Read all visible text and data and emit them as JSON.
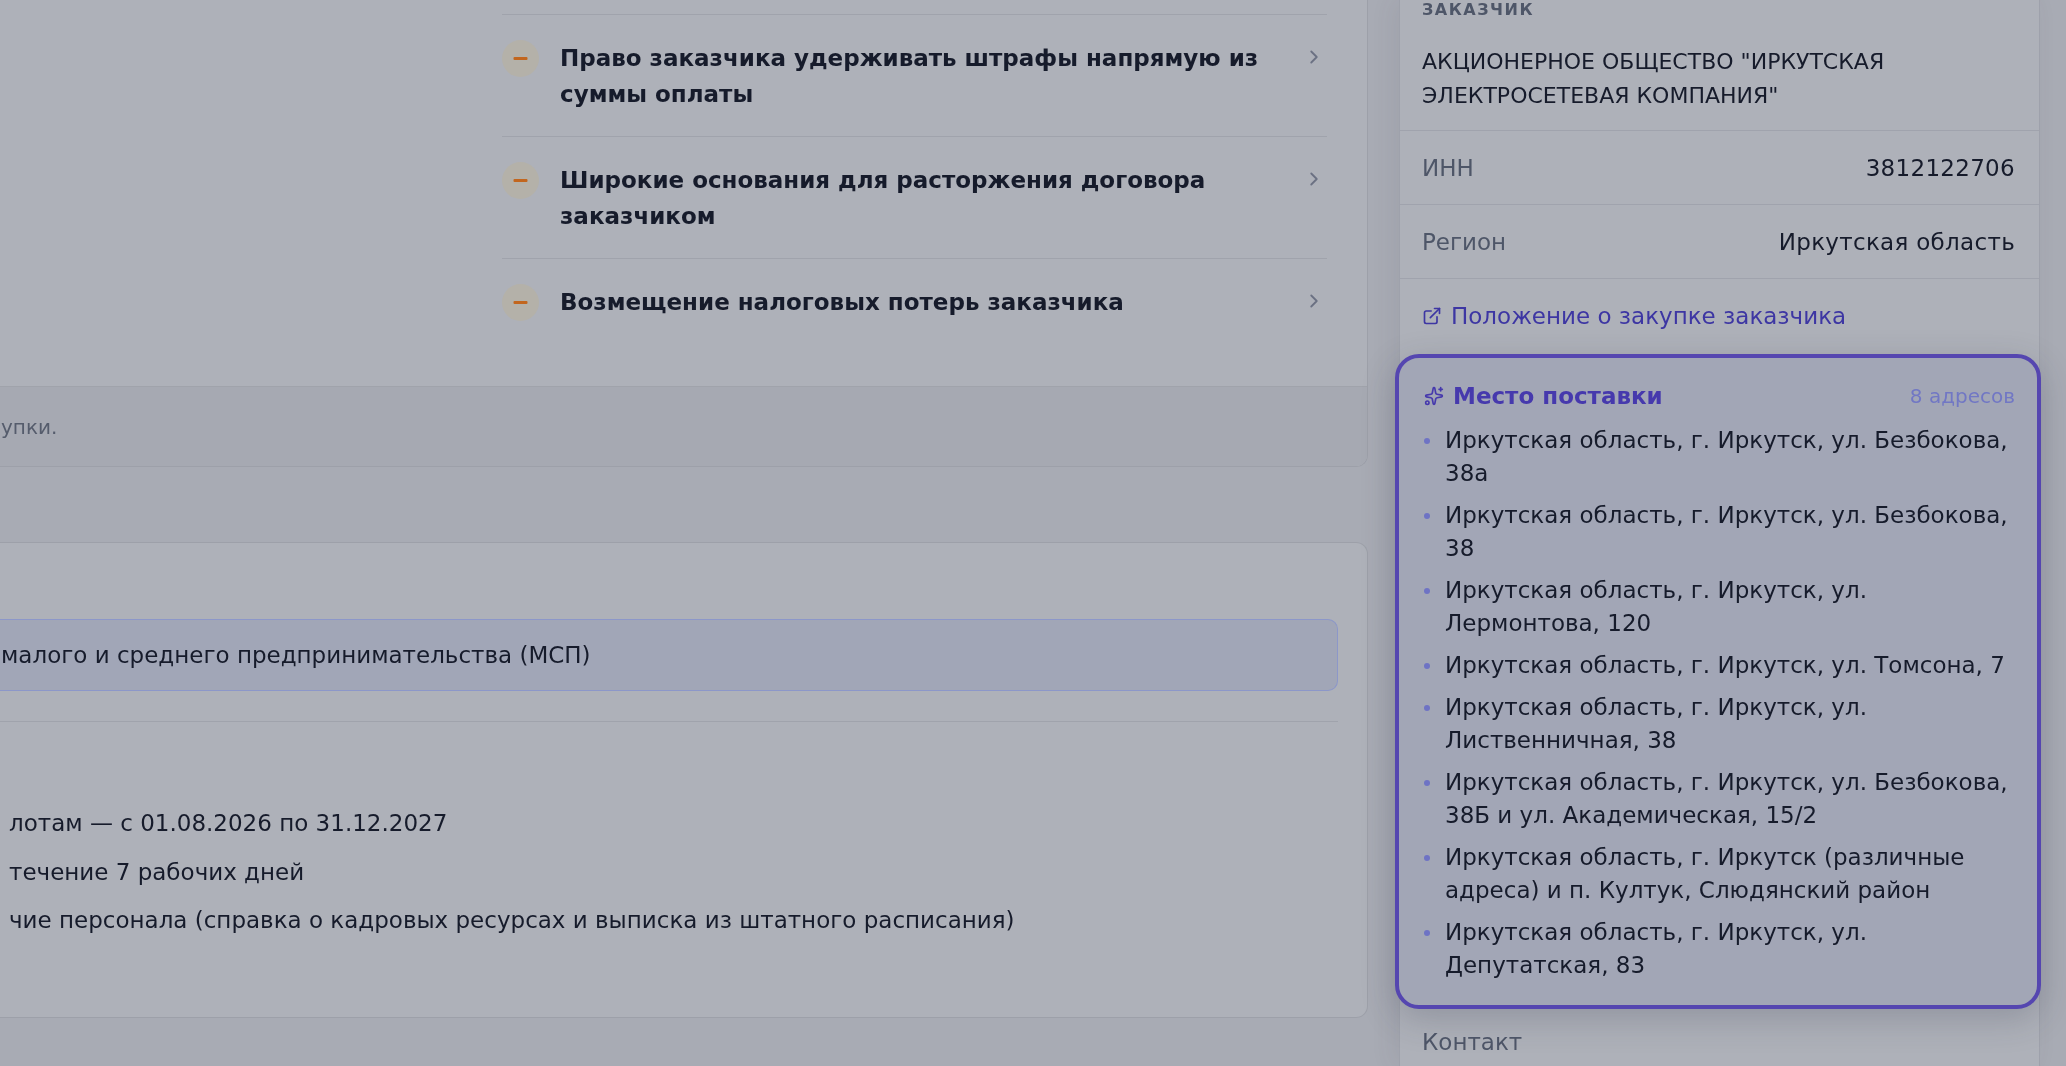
{
  "risks": {
    "items": [
      {
        "title": "Право заказчика удерживать штрафы напрямую из суммы оплаты",
        "kind": "warning"
      },
      {
        "title": "Широкие основания для расторжения договора заказчиком",
        "kind": "warning"
      },
      {
        "title": "Возмещение налоговых потерь заказчика",
        "kind": "warning"
      }
    ],
    "footnote": "упки."
  },
  "requirements": {
    "banner": "малого и среднего предпринимательства (МСП)",
    "lines": [
      "лотам — с 01.08.2026 по 31.12.2027",
      "течение 7 рабочих дней",
      "чие персонала (справка о кадровых ресурсах и выписка из штатного расписания)"
    ]
  },
  "customer": {
    "heading": "ЗАКАЗЧИК",
    "name": "АКЦИОНЕРНОЕ ОБЩЕСТВО \"ИРКУТСКАЯ ЭЛЕКТРОСЕТЕВАЯ КОМПАНИЯ\"",
    "fields": [
      {
        "label": "ИНН",
        "value": "3812122706"
      },
      {
        "label": "Регион",
        "value": "Иркутская область"
      }
    ],
    "regulation_link": "Положение о закупке заказчика",
    "delivery": {
      "title": "Место поставки",
      "count": "8 адресов",
      "highlighted": true,
      "addresses": [
        "Иркутская область, г. Иркутск, ул. Безбокова, 38а",
        "Иркутская область, г. Иркутск, ул. Безбокова, 38",
        "Иркутская область, г. Иркутск, ул. Лермонтова, 120",
        "Иркутская область, г. Иркутск, ул. Томсона, 7",
        "Иркутская область, г. Иркутск, ул. Лиственничная, 38",
        "Иркутская область, г. Иркутск, ул. Безбокова, 38Б и ул. Академическая, 15/2",
        "Иркутская область, г. Иркутск (различные адреса) и п. Култук, Слюдянский район",
        "Иркутская область, г. Иркутск, ул. Депутатская, 83"
      ]
    },
    "contact_label": "Контакт"
  }
}
